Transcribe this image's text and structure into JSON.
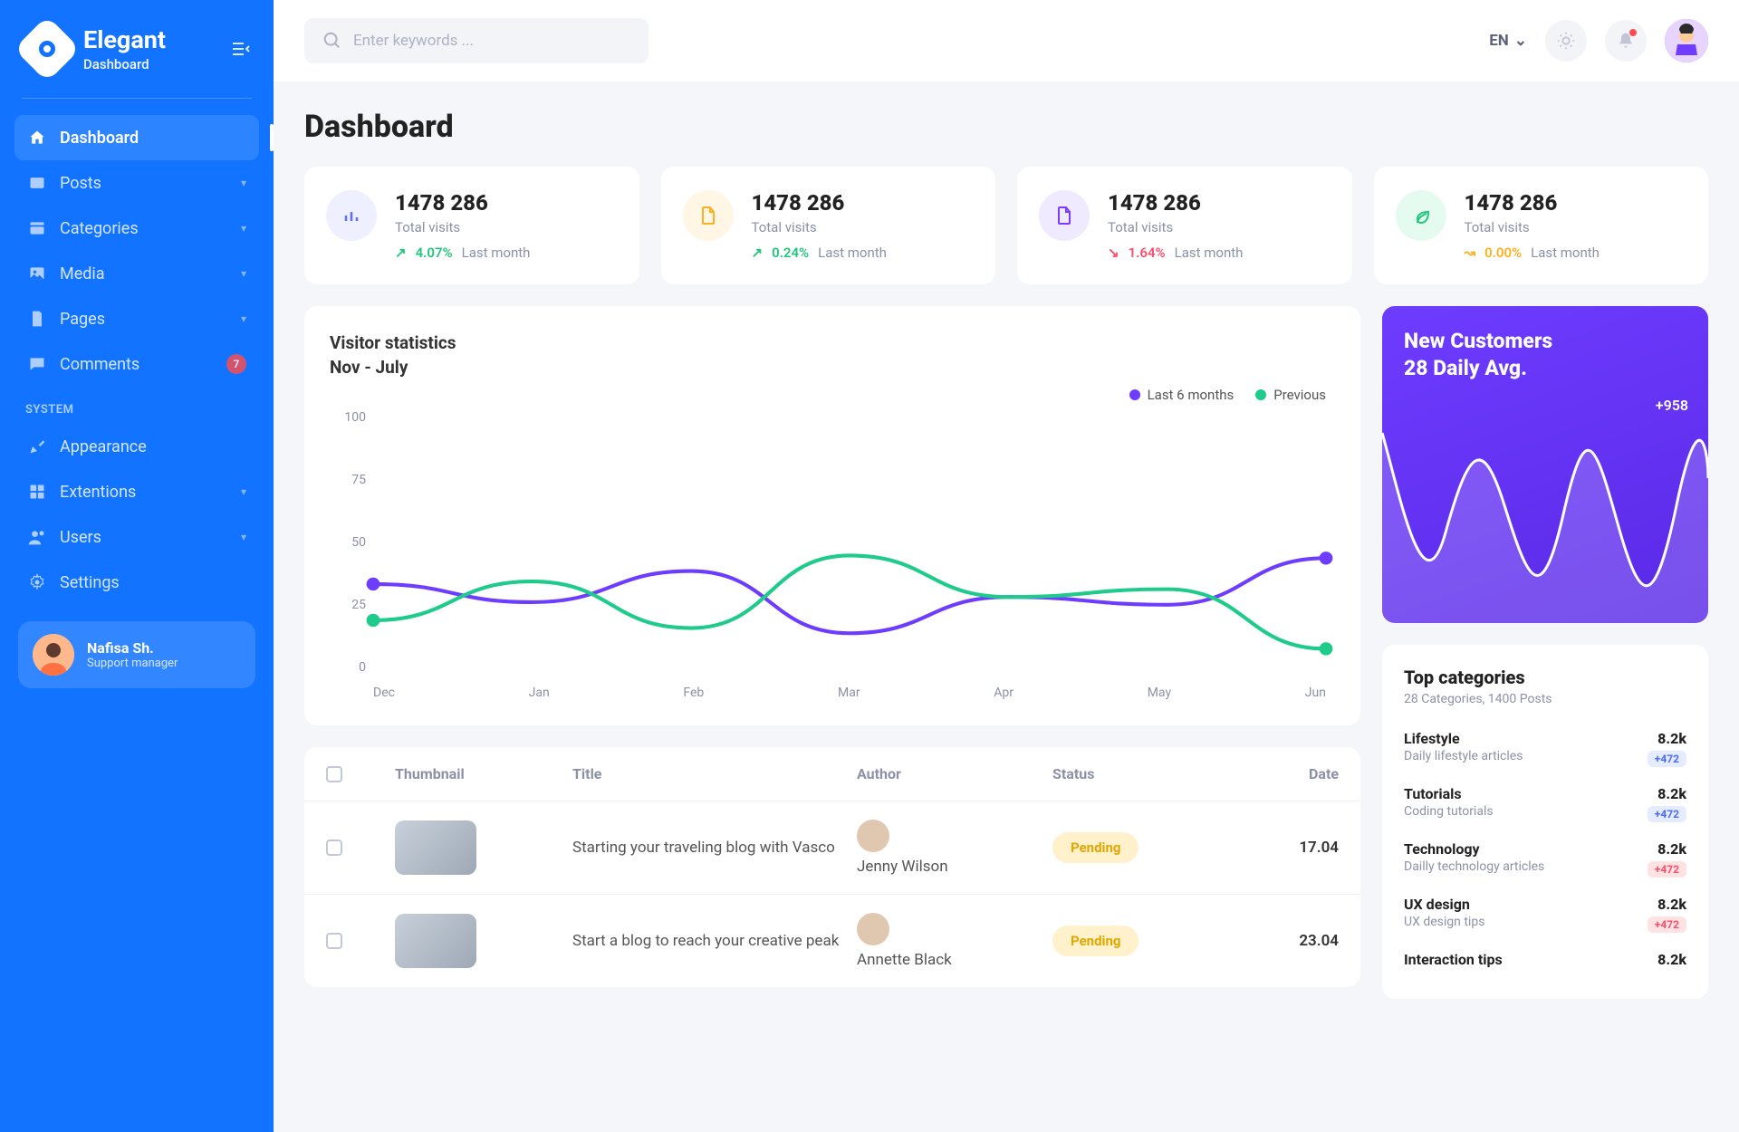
{
  "brand": {
    "name": "Elegant",
    "subtitle": "Dashboard"
  },
  "sidebar": {
    "items": [
      {
        "label": "Dashboard",
        "icon": "home-icon",
        "active": true
      },
      {
        "label": "Posts",
        "icon": "posts-icon",
        "expandable": true
      },
      {
        "label": "Categories",
        "icon": "categories-icon",
        "expandable": true
      },
      {
        "label": "Media",
        "icon": "media-icon",
        "expandable": true
      },
      {
        "label": "Pages",
        "icon": "pages-icon",
        "expandable": true
      },
      {
        "label": "Comments",
        "icon": "comments-icon",
        "badge": "7"
      }
    ],
    "section_label": "SYSTEM",
    "system_items": [
      {
        "label": "Appearance",
        "icon": "appearance-icon"
      },
      {
        "label": "Extentions",
        "icon": "extensions-icon",
        "expandable": true
      },
      {
        "label": "Users",
        "icon": "users-icon",
        "expandable": true
      },
      {
        "label": "Settings",
        "icon": "settings-icon"
      }
    ],
    "user": {
      "name": "Nafisa Sh.",
      "role": "Support manager"
    }
  },
  "search": {
    "placeholder": "Enter keywords ..."
  },
  "language": "EN",
  "page_title": "Dashboard",
  "stat_cards": [
    {
      "value": "1478 286",
      "label": "Total visits",
      "pct": "4.07%",
      "period": "Last month",
      "trend": "up",
      "color": "#22c77d",
      "icon_bg": "#eef0ff",
      "icon_color": "#5d6dff",
      "icon": "bars-icon"
    },
    {
      "value": "1478 286",
      "label": "Total visits",
      "pct": "0.24%",
      "period": "Last month",
      "trend": "up",
      "color": "#22c77d",
      "icon_bg": "#fff6e6",
      "icon_color": "#ffb020",
      "icon": "file-icon"
    },
    {
      "value": "1478 286",
      "label": "Total visits",
      "pct": "1.64%",
      "period": "Last month",
      "trend": "down",
      "color": "#ff4d6d",
      "icon_bg": "#f0eaff",
      "icon_color": "#7b3cff",
      "icon": "doc-icon"
    },
    {
      "value": "1478 286",
      "label": "Total visits",
      "pct": "0.00%",
      "period": "Last month",
      "trend": "flat",
      "color": "#ffb020",
      "icon_bg": "#e5fbef",
      "icon_color": "#22c77d",
      "icon": "leaf-icon"
    }
  ],
  "visitor_chart": {
    "title": "Visitor statistics",
    "subtitle": "Nov - July",
    "legend": [
      {
        "label": "Last 6 months",
        "color": "#6d3cff"
      },
      {
        "label": "Previous",
        "color": "#1ecb8b"
      }
    ]
  },
  "chart_data": {
    "type": "line",
    "categories": [
      "Dec",
      "Jan",
      "Feb",
      "Mar",
      "Apr",
      "May",
      "Jun"
    ],
    "ylim": [
      0,
      100
    ],
    "yTicks": [
      100,
      75,
      50,
      25,
      0
    ],
    "series": [
      {
        "name": "Last 6 months",
        "color": "#6d3cff",
        "values": [
          35,
          28,
          40,
          16,
          30,
          27,
          45
        ]
      },
      {
        "name": "Previous",
        "color": "#1ecb8b",
        "values": [
          21,
          36,
          18,
          46,
          30,
          33,
          10
        ]
      }
    ]
  },
  "promo": {
    "title1": "New Customers",
    "title2": "28 Daily Avg.",
    "delta": "+958"
  },
  "topcat": {
    "title": "Top categories",
    "subtitle": "28 Categories, 1400 Posts",
    "rows": [
      {
        "name": "Lifestyle",
        "desc": "Daily lifestyle articles",
        "value": "8.2k",
        "badge": "+472",
        "badge_color": "blue"
      },
      {
        "name": "Tutorials",
        "desc": "Coding tutorials",
        "value": "8.2k",
        "badge": "+472",
        "badge_color": "blue"
      },
      {
        "name": "Technology",
        "desc": "Dailly technology articles",
        "value": "8.2k",
        "badge": "+472",
        "badge_color": "red"
      },
      {
        "name": "UX design",
        "desc": "UX design tips",
        "value": "8.2k",
        "badge": "+472",
        "badge_color": "red"
      },
      {
        "name": "Interaction tips",
        "desc": "",
        "value": "8.2k",
        "badge": "",
        "badge_color": ""
      }
    ]
  },
  "table": {
    "headers": {
      "thumbnail": "Thumbnail",
      "title": "Title",
      "author": "Author",
      "status": "Status",
      "date": "Date"
    },
    "rows": [
      {
        "title": "Starting your traveling blog with Vasco",
        "author": "Jenny Wilson",
        "status": "Pending",
        "date": "17.04"
      },
      {
        "title": "Start a blog to reach your creative peak",
        "author": "Annette Black",
        "status": "Pending",
        "date": "23.04"
      }
    ]
  }
}
